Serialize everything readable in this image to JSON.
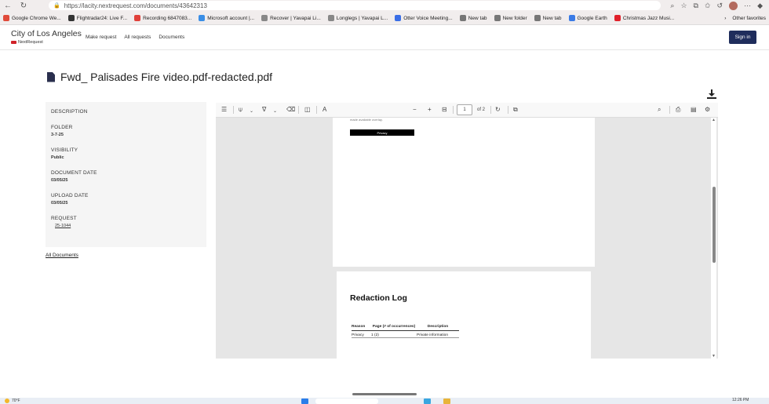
{
  "browser": {
    "url": "https://lacity.nextrequest.com/documents/43642313",
    "bookmarks": [
      {
        "label": "Google Chrome We...",
        "color": "#e04a3a"
      },
      {
        "label": "Flightradar24: Live F...",
        "color": "#333333"
      },
      {
        "label": "Recording 6847083...",
        "color": "#e0403a"
      },
      {
        "label": "Microsoft account |...",
        "color": "#3a8ee6"
      },
      {
        "label": "Recover | Yavapai Li...",
        "color": "#888888"
      },
      {
        "label": "Longlegs | Yavapai L...",
        "color": "#888888"
      },
      {
        "label": "Otter Voice Meeting...",
        "color": "#3a6ee6"
      },
      {
        "label": "New tab",
        "color": "#777777"
      },
      {
        "label": "New folder",
        "color": "#777777"
      },
      {
        "label": "New tab",
        "color": "#777777"
      },
      {
        "label": "Google Earth",
        "color": "#3a7be6"
      },
      {
        "label": "Christmas Jazz Musi...",
        "color": "#e0202a"
      }
    ],
    "other_favorites": "Other favorites"
  },
  "header": {
    "title": "City of Los Angeles",
    "subtitle": "NextRequest",
    "nav": [
      "Make request",
      "All requests",
      "Documents"
    ],
    "signin": "Sign in"
  },
  "document": {
    "title": "Fwd_ Palisades Fire video.pdf-redacted.pdf"
  },
  "meta": {
    "description_label": "DESCRIPTION",
    "folder_label": "FOLDER",
    "folder_value": "3-7-25",
    "visibility_label": "VISIBILITY",
    "visibility_value": "Public",
    "document_date_label": "DOCUMENT DATE",
    "document_date_value": "03/05/25",
    "upload_date_label": "UPLOAD DATE",
    "upload_date_value": "03/05/25",
    "request_label": "REQUEST",
    "request_value": "25-1044",
    "all_documents": "All Documents"
  },
  "viewer": {
    "page": "1",
    "page_total": "of 2",
    "page1_text": "made available overlay.",
    "redaction_label": "Privacy",
    "log_title": "Redaction Log",
    "log_headers": [
      "Reason",
      "Page (# of occurrences)",
      "Description"
    ],
    "log_rows": [
      {
        "reason": "Privacy",
        "page": "1 (2)",
        "description": "Private information"
      }
    ]
  },
  "taskbar": {
    "weather": "70°F",
    "time": "12:26 PM"
  }
}
